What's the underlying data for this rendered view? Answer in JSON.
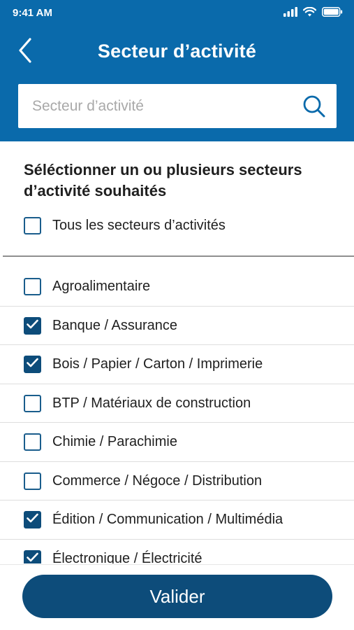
{
  "status_bar": {
    "time": "9:41 AM"
  },
  "nav": {
    "title": "Secteur d’activité"
  },
  "search": {
    "placeholder": "Secteur d’activité",
    "value": ""
  },
  "section_title": "Séléctionner un ou plusieurs secteurs d’activité souhaités",
  "all_option": {
    "label": "Tous les secteurs d’activités",
    "checked": false
  },
  "sectors": [
    {
      "label": "Agroalimentaire",
      "checked": false
    },
    {
      "label": "Banque / Assurance",
      "checked": true
    },
    {
      "label": "Bois / Papier / Carton / Imprimerie",
      "checked": true
    },
    {
      "label": "BTP / Matériaux de construction",
      "checked": false
    },
    {
      "label": "Chimie / Parachimie",
      "checked": false
    },
    {
      "label": "Commerce / Négoce / Distribution",
      "checked": false
    },
    {
      "label": "Édition / Communication / Multimédia",
      "checked": true
    },
    {
      "label": "Électronique / Électricité",
      "checked": true
    }
  ],
  "footer": {
    "submit_label": "Valider"
  },
  "colors": {
    "header_bg": "#0a6aab",
    "button_bg": "#0d4c7a",
    "checkbox_checked": "#0d4c7a"
  }
}
